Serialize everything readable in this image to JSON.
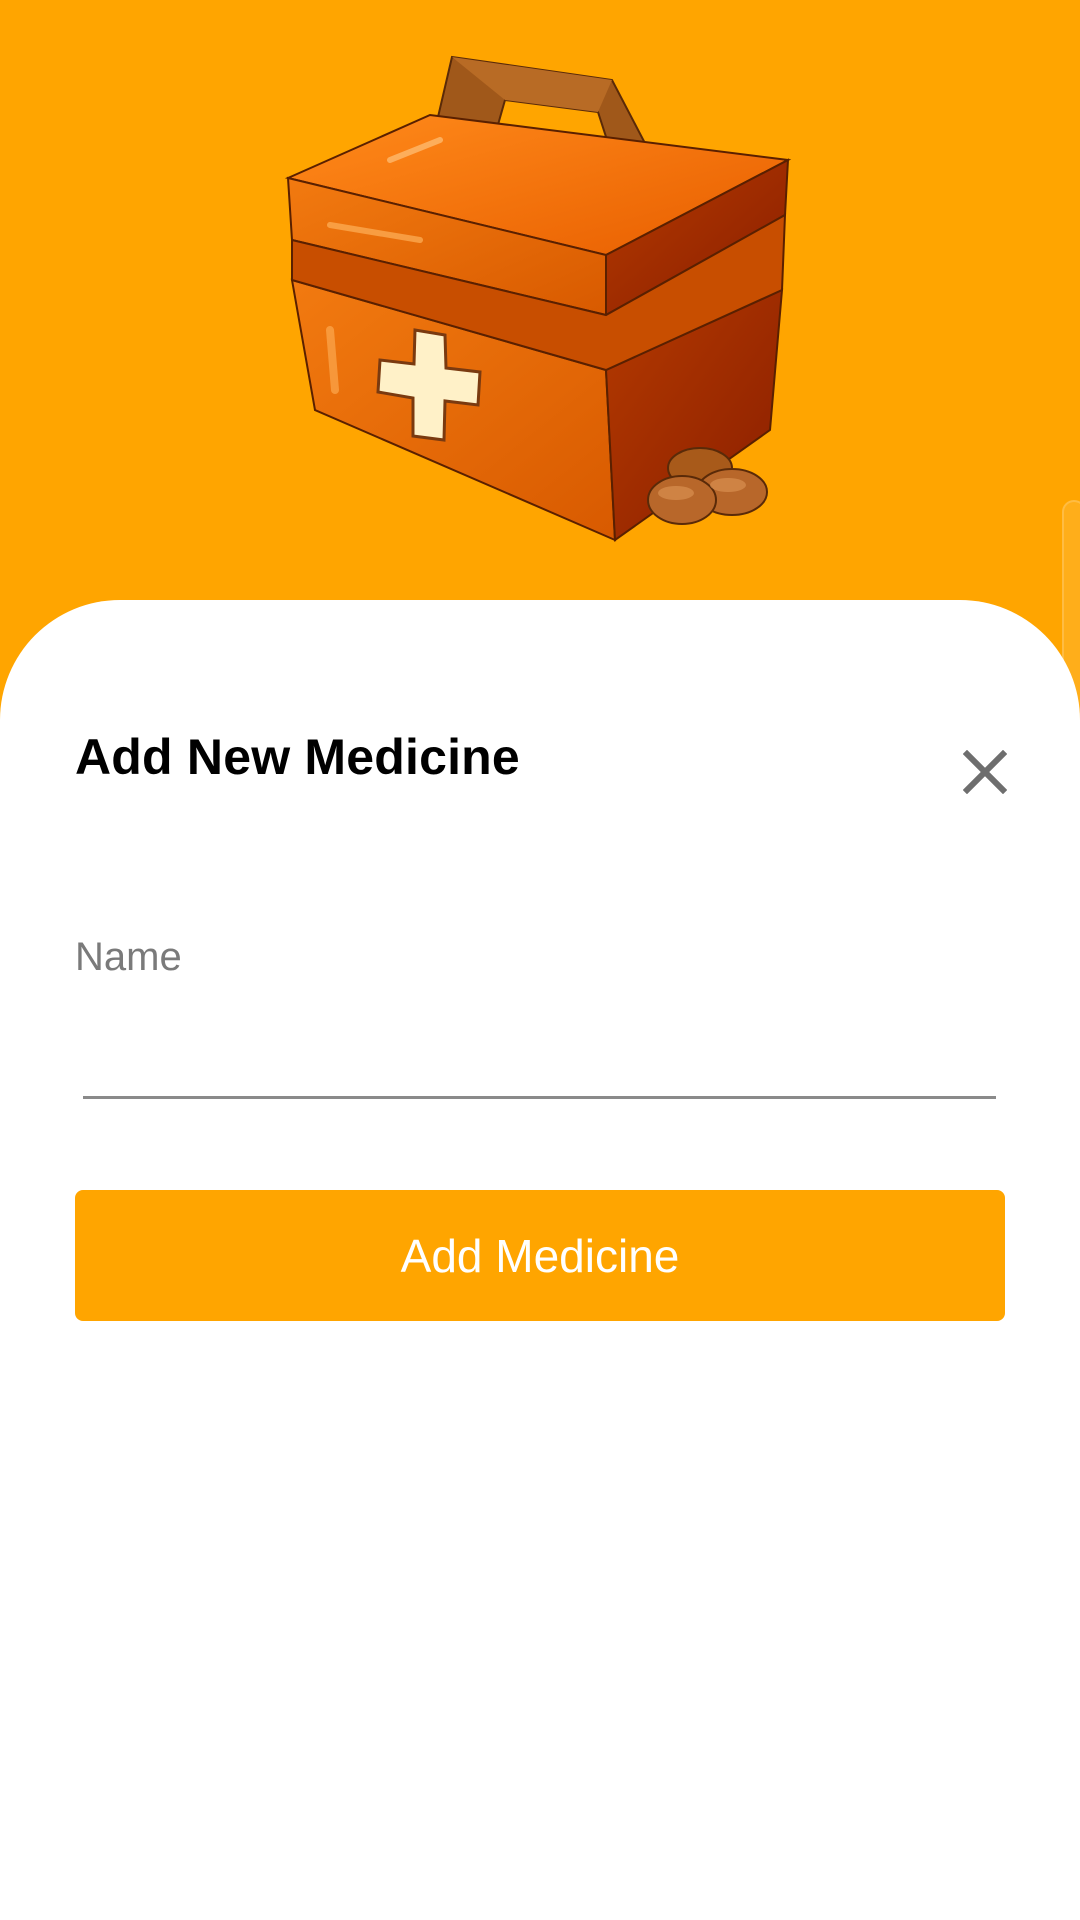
{
  "theme": {
    "accent": "#FFA500",
    "sheet_background": "#FFFFFF"
  },
  "hero": {
    "illustration": "medicine-box"
  },
  "sheet": {
    "title": "Add New Medicine",
    "close_icon": "close-icon"
  },
  "form": {
    "name_label": "Name",
    "name_value": ""
  },
  "actions": {
    "submit_label": "Add Medicine"
  }
}
